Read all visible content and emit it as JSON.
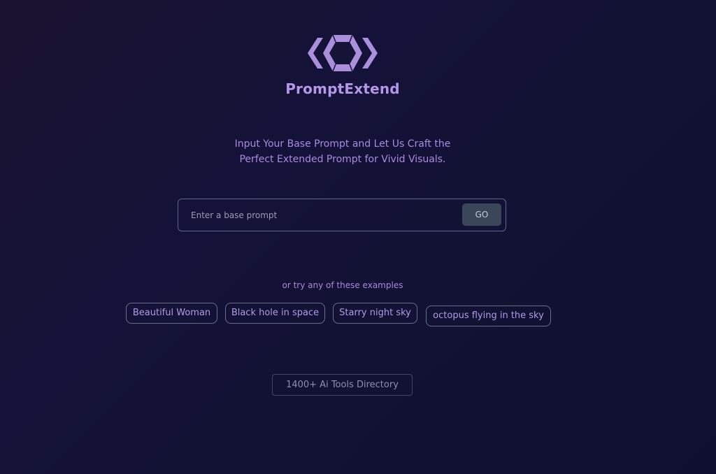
{
  "brand": {
    "logo_icon": "hexagon-chevrons-logo-icon",
    "name": "PromptExtend",
    "color": "#b497e6"
  },
  "tagline": {
    "line1": "Input Your Base Prompt and Let Us Craft the",
    "line2": "Perfect Extended Prompt for Vivid Visuals."
  },
  "search": {
    "placeholder": "Enter a base prompt",
    "value": "",
    "go_label": "GO"
  },
  "examples": {
    "label": "or try any of these examples",
    "items": [
      "Beautiful Woman",
      "Black hole in space",
      "Starry night sky",
      "octopus flying in the sky"
    ]
  },
  "directory_link": "1400+ Ai Tools Directory",
  "colors": {
    "accent": "#b497e6",
    "background": "#141238",
    "button": "#3a4759"
  }
}
